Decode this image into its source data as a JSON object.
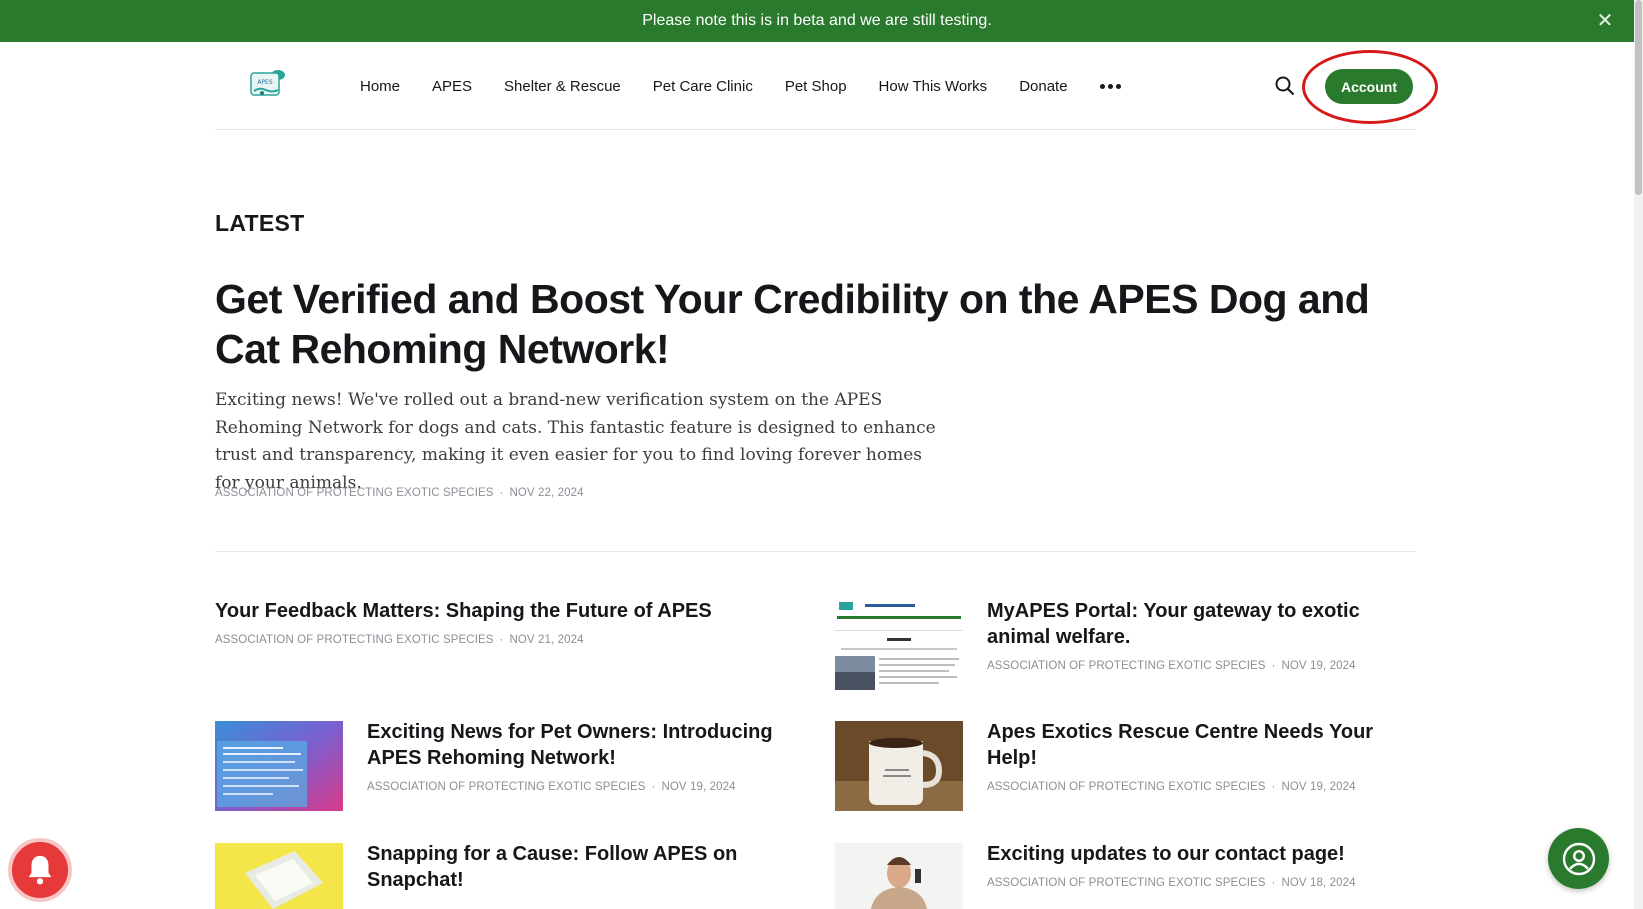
{
  "banner": {
    "text": "Please note this is in beta and we are still testing.",
    "close_icon": "close-icon",
    "color": "#2a7a2d"
  },
  "header": {
    "logo_icon": "apes-logo",
    "nav": [
      "Home",
      "APES",
      "Shelter & Rescue",
      "Pet Care Clinic",
      "Pet Shop",
      "How This Works",
      "Donate"
    ],
    "more_icon": "more-dots-icon",
    "search_icon": "search-icon",
    "account_label": "Account",
    "accent_color": "#2a7a2d",
    "highlight_color": "#d61a1a"
  },
  "main": {
    "section_title": "LATEST",
    "feature": {
      "title": "Get Verified and Boost Your Credibility on the APES Dog and Cat Rehoming Network!",
      "excerpt": "Exciting news! We've rolled out a brand-new verification system on the APES Rehoming Network for dogs and cats. This fantastic feature is designed to enhance trust and transparency, making it even easier for you to find loving forever homes for your animals.",
      "author": "ASSOCIATION OF PROTECTING EXOTIC SPECIES",
      "date": "NOV 22, 2024"
    },
    "posts": [
      {
        "title": "Your Feedback Matters: Shaping the Future of APES",
        "author": "ASSOCIATION OF PROTECTING EXOTIC SPECIES",
        "date": "NOV 21, 2024"
      },
      {
        "title": "MyAPES Portal: Your gateway to exotic animal welfare.",
        "author": "ASSOCIATION OF PROTECTING EXOTIC SPECIES",
        "date": "NOV 19, 2024"
      },
      {
        "title": "Exciting News for Pet Owners: Introducing APES Rehoming Network!",
        "author": "ASSOCIATION OF PROTECTING EXOTIC SPECIES",
        "date": "NOV 19, 2024"
      },
      {
        "title": "Apes Exotics Rescue Centre Needs Your Help!",
        "author": "ASSOCIATION OF PROTECTING EXOTIC SPECIES",
        "date": "NOV 19, 2024"
      },
      {
        "title": "Snapping for a Cause: Follow APES on Snapchat!",
        "author": "",
        "date": ""
      },
      {
        "title": "Exciting updates to our contact page!",
        "author": "ASSOCIATION OF PROTECTING EXOTIC SPECIES",
        "date": "NOV 18, 2024"
      }
    ]
  },
  "widgets": {
    "notification_icon": "bell-icon",
    "notification_color": "#e63a3a",
    "support_icon": "person-chat-icon"
  }
}
